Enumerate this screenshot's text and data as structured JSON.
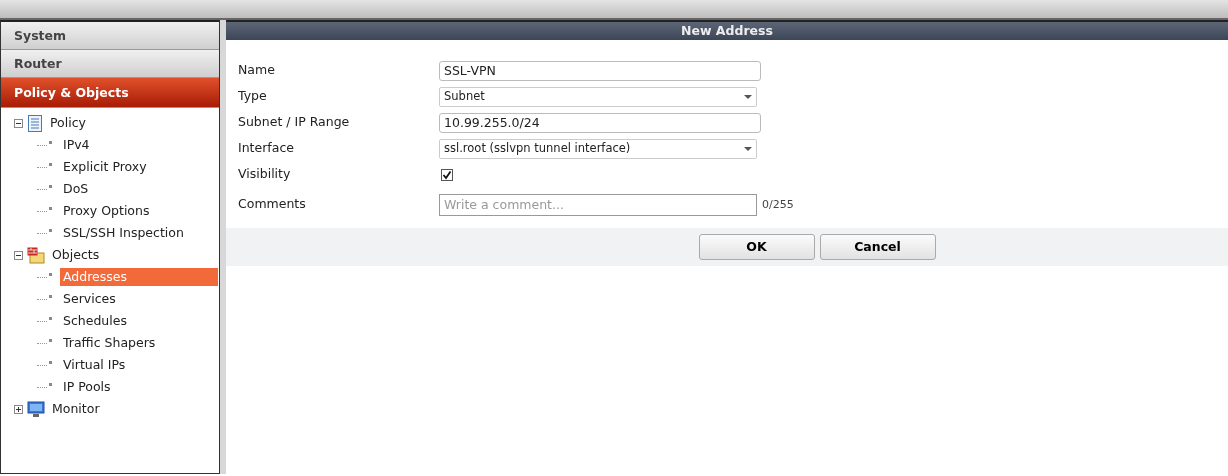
{
  "sidebar": {
    "sections": [
      {
        "label": "System",
        "selected": false
      },
      {
        "label": "Router",
        "selected": false
      },
      {
        "label": "Policy & Objects",
        "selected": true
      }
    ],
    "tree": [
      {
        "label": "Policy",
        "kind": "list",
        "expanded": true,
        "children": [
          {
            "label": "IPv4",
            "selected": false
          },
          {
            "label": "Explicit Proxy",
            "selected": false
          },
          {
            "label": "DoS",
            "selected": false
          },
          {
            "label": "Proxy Options",
            "selected": false
          },
          {
            "label": "SSL/SSH Inspection",
            "selected": false
          }
        ]
      },
      {
        "label": "Objects",
        "kind": "folder",
        "expanded": true,
        "children": [
          {
            "label": "Addresses",
            "selected": true
          },
          {
            "label": "Services",
            "selected": false
          },
          {
            "label": "Schedules",
            "selected": false
          },
          {
            "label": "Traffic Shapers",
            "selected": false
          },
          {
            "label": "Virtual IPs",
            "selected": false
          },
          {
            "label": "IP Pools",
            "selected": false
          }
        ]
      },
      {
        "label": "Monitor",
        "kind": "monitor",
        "expanded": false
      }
    ]
  },
  "dialog": {
    "title": "New Address",
    "fields": [
      {
        "label": "Name",
        "kind": "text",
        "value": "SSL-VPN"
      },
      {
        "label": "Type",
        "kind": "select",
        "value": "Subnet"
      },
      {
        "label": "Subnet / IP Range",
        "kind": "text",
        "value": "10.99.255.0/24"
      },
      {
        "label": "Interface",
        "kind": "select",
        "value": "ssl.root (sslvpn tunnel interface)"
      },
      {
        "label": "Visibility",
        "kind": "checkbox",
        "checked": true
      },
      {
        "label": "Comments",
        "kind": "comment",
        "placeholder": "Write a comment...",
        "counter": "0/255"
      }
    ],
    "buttons": [
      "OK",
      "Cancel"
    ]
  }
}
